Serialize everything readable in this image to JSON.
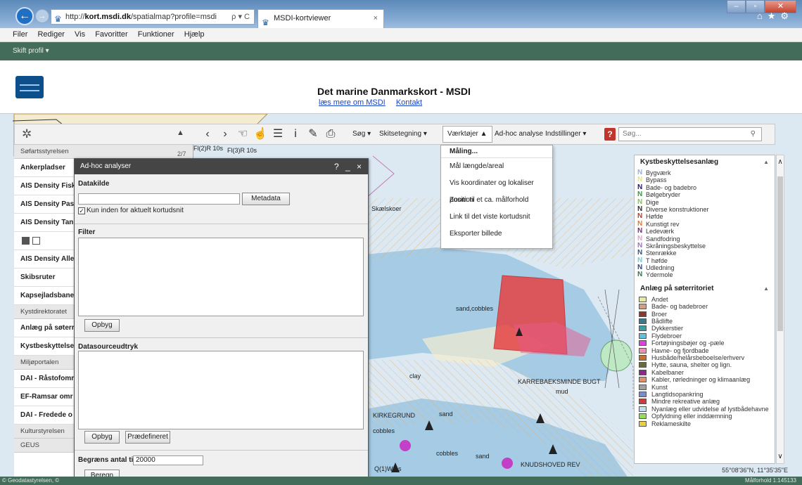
{
  "browser": {
    "url": "http://kort.msdi.dk/spatialmap?profile=msdi",
    "url_domain_bold": "kort.msdi.dk",
    "tab_title": "MSDI-kortviewer",
    "tab_close": "×",
    "addr_tools": "ρ ▾ C",
    "menu": [
      "Filer",
      "Rediger",
      "Vis",
      "Favoritter",
      "Funktioner",
      "Hjælp"
    ]
  },
  "app": {
    "profile_switch": "Skift profil ▾",
    "title": "Det marine Danmarkskort - MSDI",
    "link_more": "læs mere om MSDI",
    "link_contact": "Kontakt"
  },
  "toolbar": {
    "search_menu": "Søg ▾",
    "sketch_menu": "Skitsetegning ▾",
    "tools_menu": "Værktøjer ▲",
    "adhoc_menu": "Ad-hoc analyse",
    "settings_menu": "Indstillinger ▾",
    "help": "?",
    "search_placeholder": "Søg...",
    "page_count": "2/7"
  },
  "tools_dropdown": {
    "header": "Måling...",
    "items": [
      "Mål længde/areal",
      "Vis koordinater og lokaliser position",
      "Zoom til et ca. målforhold",
      "Link til det viste kortudsnit",
      "Eksporter billede"
    ]
  },
  "layers": {
    "rows": [
      {
        "type": "cat",
        "label": "Søfartsstyrelsen"
      },
      {
        "type": "row",
        "label": "Ankerpladser"
      },
      {
        "type": "row",
        "label": "AIS Density Fisk"
      },
      {
        "type": "row",
        "label": "AIS Density Pas"
      },
      {
        "type": "row",
        "label": "AIS Density Tan"
      },
      {
        "type": "icons",
        "label": ""
      },
      {
        "type": "row",
        "label": "AIS Density Alle"
      },
      {
        "type": "row",
        "label": "Skibsruter"
      },
      {
        "type": "row",
        "label": "Kapsejladsbane"
      },
      {
        "type": "cat",
        "label": "Kystdirektoratet"
      },
      {
        "type": "row",
        "label": "Anlæg på søterr"
      },
      {
        "type": "row",
        "label": "Kystbeskyttelse"
      },
      {
        "type": "cat",
        "label": "Miljøportalen"
      },
      {
        "type": "row",
        "label": "DAI - Råstofomr"
      },
      {
        "type": "row",
        "label": "EF-Ramsar omr"
      },
      {
        "type": "row",
        "label": "DAI - Fredede o"
      },
      {
        "type": "cat",
        "label": "Kulturstyrelsen"
      },
      {
        "type": "cat",
        "label": "GEUS"
      }
    ]
  },
  "adhoc": {
    "title": "Ad-hoc analyser",
    "controls": "? _ ×",
    "datasource_label": "Datakilde",
    "metadata_button": "Metadata",
    "only_current_view": "Kun inden for aktuelt kortudsnit",
    "filter_label": "Filter",
    "build_button": "Opbyg",
    "expression_label": "Datasourceudtryk",
    "build_button2": "Opbyg",
    "predefined_button": "Prædefineret",
    "limit_label": "Begræns antal til",
    "limit_value": "20000",
    "compute_button": "Beregn"
  },
  "legend": {
    "section1": {
      "title": "Kystbeskyttelsesanlæg",
      "items": [
        {
          "label": "Bygværk",
          "color": "#8fb3e0"
        },
        {
          "label": "Bypass",
          "color": "#e8e870"
        },
        {
          "label": "Bade- og badebro",
          "color": "#1b1b7a"
        },
        {
          "label": "Bølgebryder",
          "color": "#2f9e3a"
        },
        {
          "label": "Dige",
          "color": "#7fc94a"
        },
        {
          "label": "Diverse konstruktioner",
          "color": "#333333"
        },
        {
          "label": "Høfde",
          "color": "#c23a2a"
        },
        {
          "label": "Kunstigt rev",
          "color": "#e07a2a"
        },
        {
          "label": "Ledeværk",
          "color": "#7a2a7a"
        },
        {
          "label": "Sandfodring",
          "color": "#e8a0d0"
        },
        {
          "label": "Skråningsbeskyttelse",
          "color": "#a070d0"
        },
        {
          "label": "Stenrække",
          "color": "#2a5a8a"
        },
        {
          "label": "T høfde",
          "color": "#6ad0e0"
        },
        {
          "label": "Udledning",
          "color": "#2a4a9a"
        },
        {
          "label": "Ydermole",
          "color": "#2a7a4a"
        }
      ]
    },
    "section2": {
      "title": "Anlæg på søterritoriet",
      "items": [
        {
          "label": "Andet",
          "color": "#e8e8a0"
        },
        {
          "label": "Bade- og badebroer",
          "color": "#d0a080"
        },
        {
          "label": "Broer",
          "color": "#8a3a2a"
        },
        {
          "label": "Bådlifte",
          "color": "#3a7a8a"
        },
        {
          "label": "Dykkerstier",
          "color": "#3aa0a0"
        },
        {
          "label": "Flydebroer",
          "color": "#60c0e0"
        },
        {
          "label": "Fortøjningsbøjer og -pæle",
          "color": "#e040e0"
        },
        {
          "label": "Havne- og fjordbade",
          "color": "#e890b0"
        },
        {
          "label": "Husbåde/helårsbeboelse/erhverv",
          "color": "#c8702a"
        },
        {
          "label": "Hytte, sauna, shelter og lign.",
          "color": "#6a6a3a"
        },
        {
          "label": "Kabelbaner",
          "color": "#8a2a8a"
        },
        {
          "label": "Kabler, rørledninger og klimaanlæg",
          "color": "#e09070"
        },
        {
          "label": "Kunst",
          "color": "#a0a0a0"
        },
        {
          "label": "Langtidsopankring",
          "color": "#7090d0"
        },
        {
          "label": "Mindre rekreative anlæg",
          "color": "#d03a3a"
        },
        {
          "label": "Nyanlæg eller udvidelse af lystbådehavne",
          "color": "#c0e0f0"
        },
        {
          "label": "Opfyldning eller inddæmning",
          "color": "#90e050"
        },
        {
          "label": "Reklameskilte",
          "color": "#e8d040"
        }
      ]
    }
  },
  "map_labels": {
    "skaelskoer": "Skælskoer",
    "sand_cobbles": "sand,cobbles",
    "clay": "clay",
    "karrebaek": "KARREBAEKSMINDE BUGT",
    "mud": "mud",
    "kirkegrund": "KIRKEGRUND",
    "sand1": "sand",
    "cobbles1": "cobbles",
    "cobbles2": "cobbles",
    "sand2": "sand",
    "knudshoved": "KNUDSHOVED REV",
    "q1w": "Q(1)W 1s",
    "fl2r": "Fl(2)R 10s",
    "fl3r": "Fl(3)R 10s"
  },
  "footer": {
    "copyright": "© Geodatastyrelsen, ©",
    "scale": "Målforhold 1:145133",
    "coords": "55°08'36\"N, 11°35'35\"E"
  },
  "colors": {
    "brand_green": "#446c5a",
    "red_area": "#e83a3a",
    "land": "#f3ecd0",
    "sea_shallow": "#a6cbe4"
  }
}
